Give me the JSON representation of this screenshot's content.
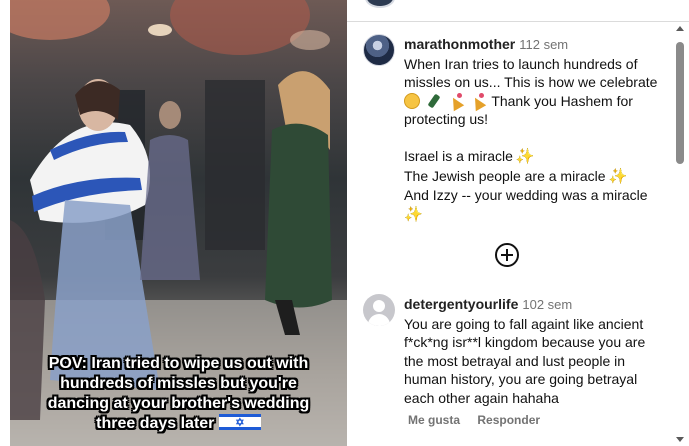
{
  "media": {
    "caption_lines": [
      "POV: Iran tried to wipe us out with",
      "hundreds of missles but you're",
      "dancing at your brother's wedding",
      "three days later"
    ],
    "caption_emoji": "israel-flag-emoji"
  },
  "comments": [
    {
      "username": "marathonmother",
      "time": "112 sem",
      "lines": [
        "When Iran tries to launch hundreds of",
        "missles on us... This is how we celebrate",
        "Thank you Hashem for",
        "protecting us!",
        "Israel is a miracle",
        "The Jewish people are a miracle",
        "And Izzy -- your wedding was a miracle"
      ],
      "emojis": [
        "face-emoji",
        "bottle-emoji",
        "party-popper-emoji",
        "party-popper-emoji",
        "sparkles-emoji"
      ]
    },
    {
      "username": "detergentyourlife",
      "time": "102 sem",
      "lines": [
        "You are going to fall againt like ancient",
        "f*ck*ng isr**l kingdom because you are",
        "the most betrayal and lust people in",
        "human history, you are going betrayal",
        "each other again hahaha"
      ],
      "actions": {
        "like": "Me gusta",
        "reply": "Responder"
      }
    }
  ],
  "colors": {
    "muted": "#737373",
    "text": "#111111",
    "flag_blue": "#1e5bd6"
  }
}
